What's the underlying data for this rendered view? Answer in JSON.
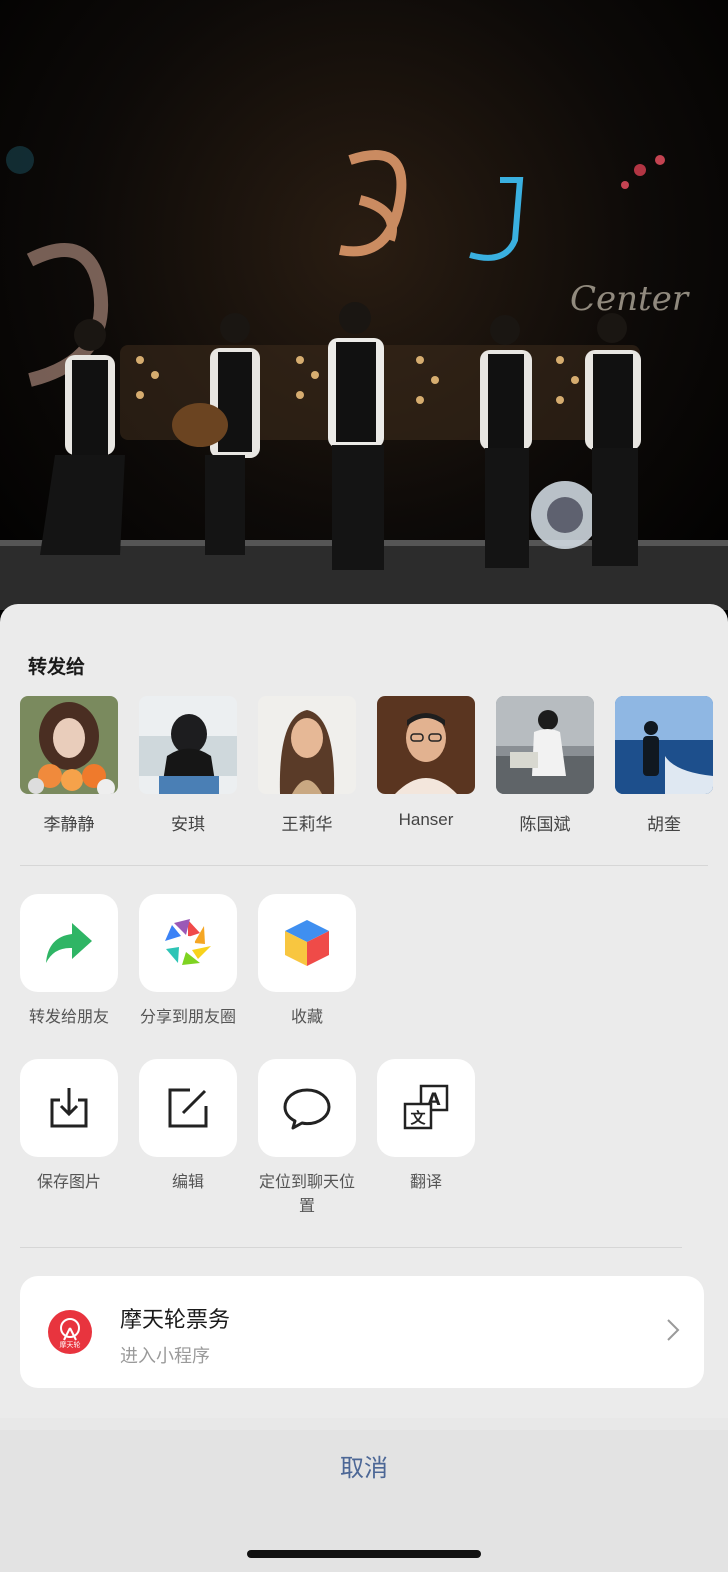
{
  "sheet": {
    "title": "转发给",
    "contacts": [
      {
        "name": "李静静"
      },
      {
        "name": "安琪"
      },
      {
        "name": "王莉华"
      },
      {
        "name": "Hanser"
      },
      {
        "name": "陈国斌"
      },
      {
        "name": "胡奎"
      }
    ],
    "actions_row1": [
      {
        "label": "转发给朋友",
        "icon": "forward-arrow-icon"
      },
      {
        "label": "分享到朋友圈",
        "icon": "moments-aperture-icon"
      },
      {
        "label": "收藏",
        "icon": "favorite-cube-icon"
      }
    ],
    "actions_row2": [
      {
        "label": "保存图片",
        "icon": "download-icon"
      },
      {
        "label": "编辑",
        "icon": "edit-icon"
      },
      {
        "label": "定位到聊天位置",
        "icon": "chat-bubble-icon"
      },
      {
        "label": "翻译",
        "icon": "translate-icon"
      }
    ],
    "mini_program": {
      "title": "摩天轮票务",
      "subtitle": "进入小程序",
      "logo_text": "摩天轮"
    },
    "cancel_label": "取消"
  },
  "colors": {
    "sheet_bg": "#ebebeb",
    "cancel_text": "#4c6796",
    "logo_red": "#e8343e",
    "forward_green": "#2fb565"
  }
}
